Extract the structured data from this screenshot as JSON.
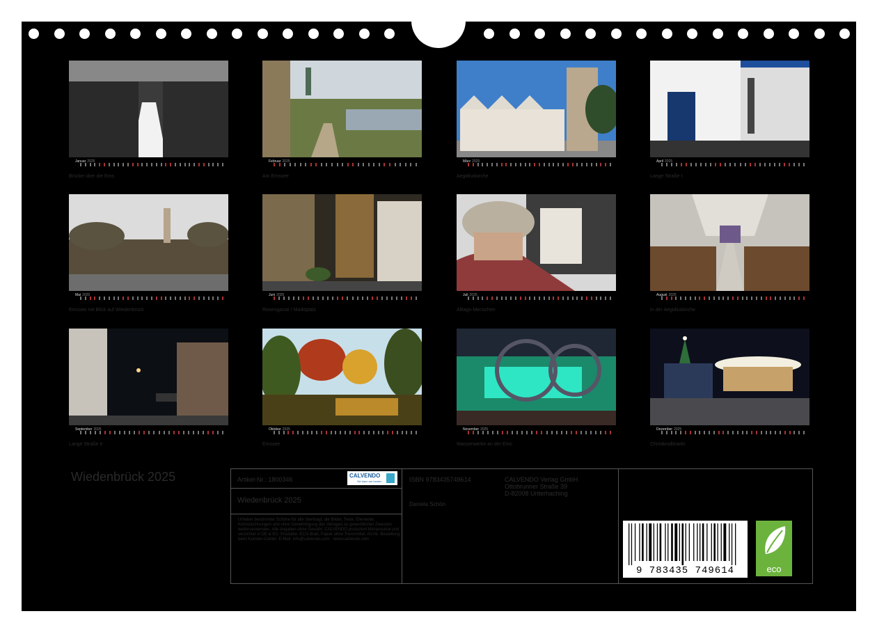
{
  "calendar_title": "Wiedenbrück 2025",
  "year": "2025",
  "months": [
    {
      "name": "Januar",
      "caption": "Brücke über die Ems"
    },
    {
      "name": "Februar",
      "caption": "Am Emssee"
    },
    {
      "name": "März",
      "caption": "Aegidiuskirche"
    },
    {
      "name": "April",
      "caption": "Lange Straße I"
    },
    {
      "name": "Mai",
      "caption": "Emssee mit Blick auf Wiedenbrück"
    },
    {
      "name": "Juni",
      "caption": "Rosengasse / Marktplatz"
    },
    {
      "name": "Juli",
      "caption": "Alltags-Menschen"
    },
    {
      "name": "August",
      "caption": "In der Aegidiuskirche"
    },
    {
      "name": "September",
      "caption": "Lange Straße II"
    },
    {
      "name": "Oktober",
      "caption": "Emssee"
    },
    {
      "name": "November",
      "caption": "Wasserwerke an der Ems"
    },
    {
      "name": "Dezember",
      "caption": "Christkindlmarkt"
    }
  ],
  "info": {
    "article_no": "Artikel-Nr.: 1800346",
    "logo_text": "CALVENDO",
    "logo_sub": "Sie kann am besten",
    "product_title": "Wiedenbrück 2025",
    "isbn": "ISBN 9783435749614",
    "publisher_name": "CALVENDO Verlag GmbH",
    "publisher_street": "Ottobrunner Straße 39",
    "publisher_city": "D-82008 Unterhaching",
    "author": "Daniela Schön",
    "legal": "Urheber bestimmter Schöne für alle übertragt, die Bilder, Texte, Elemente, Kennzeichnungen und ohne Genehmigung des Verlages zu gewerblichen Zwecken weiterverwenden. Alle Angaben ohne Gewähr. CALVENDO produziert klimaneutral und verzichtet in DE & EU. Produkte: ECO-Blatt, Papier ohne Trennmittel. Art-Nr. Bestellung beim Kunden-Center. E-Mail: info@calvendo.com · www.calvendo.com",
    "barcode_number": "9 783435 749614",
    "eco_label": "eco"
  }
}
